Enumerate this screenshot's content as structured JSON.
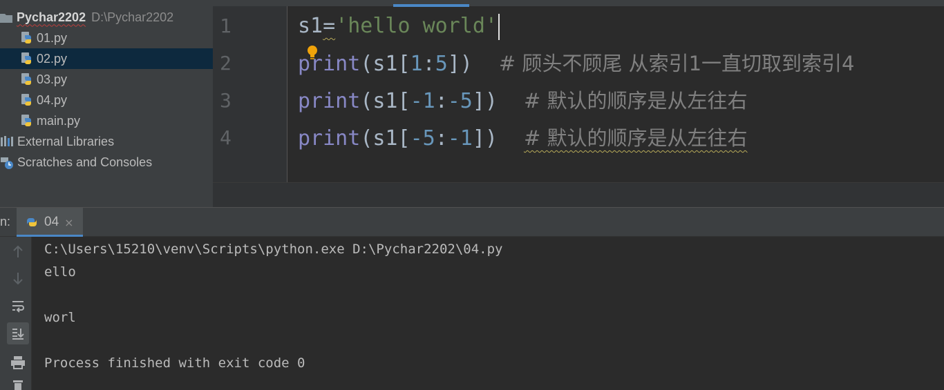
{
  "project": {
    "root_name": "Pychar2202",
    "root_path": "D:\\Pychar2202",
    "files": [
      {
        "name": "01.py",
        "icon": "python-file-icon"
      },
      {
        "name": "02.py",
        "icon": "python-file-icon",
        "selected": true
      },
      {
        "name": "03.py",
        "icon": "python-file-icon"
      },
      {
        "name": "04.py",
        "icon": "python-file-icon"
      },
      {
        "name": "main.py",
        "icon": "python-file-icon"
      }
    ],
    "external_libraries": "External Libraries",
    "scratches": "Scratches and Consoles"
  },
  "editor": {
    "line_numbers": [
      "1",
      "2",
      "3",
      "4"
    ],
    "lines": [
      "s1='hello world'",
      "print(s1[1:5])  # 顾头不顾尾 从索引1一直切取到索引4",
      "print(s1[-1:-5])  # 默认的顺序是从左往右",
      "print(s1[-5:-1])  # 默认的顺序是从左往右"
    ],
    "tokens": {
      "var": "s1",
      "eq": "=",
      "str": "'hello world'",
      "fn": "print",
      "open": "(s1[",
      "close": "])",
      "colon": ":",
      "l2_a": "1",
      "l2_b": "5",
      "l3_a": "-1",
      "l3_b": "-5",
      "l4_a": "-5",
      "l4_b": "-1",
      "l2_comment": "# 顾头不顾尾 从索引1一直切取到索引4",
      "l3_comment": "# 默认的顺序是从左往右",
      "l4_comment": "# 默认的顺序是从左往右"
    }
  },
  "run": {
    "label": "n:",
    "tab_label": "04",
    "tab_close": "×",
    "toolbar_icons": [
      "up-arrow-icon",
      "down-arrow-icon",
      "soft-wrap-icon",
      "scroll-to-end-icon",
      "print-icon",
      "trash-icon"
    ],
    "console": [
      "C:\\Users\\15210\\venv\\Scripts\\python.exe D:\\Pychar2202\\04.py",
      "ello",
      "",
      "worl",
      "",
      "Process finished with exit code 0"
    ]
  },
  "colors": {
    "editor_bg": "#2b2b2b",
    "sidebar_bg": "#3c3f41",
    "selection": "#0d293e",
    "keyword_fn": "#8888c6",
    "string": "#6a8759",
    "number": "#6897bb",
    "comment": "#808080",
    "accent": "#4a88c7"
  }
}
